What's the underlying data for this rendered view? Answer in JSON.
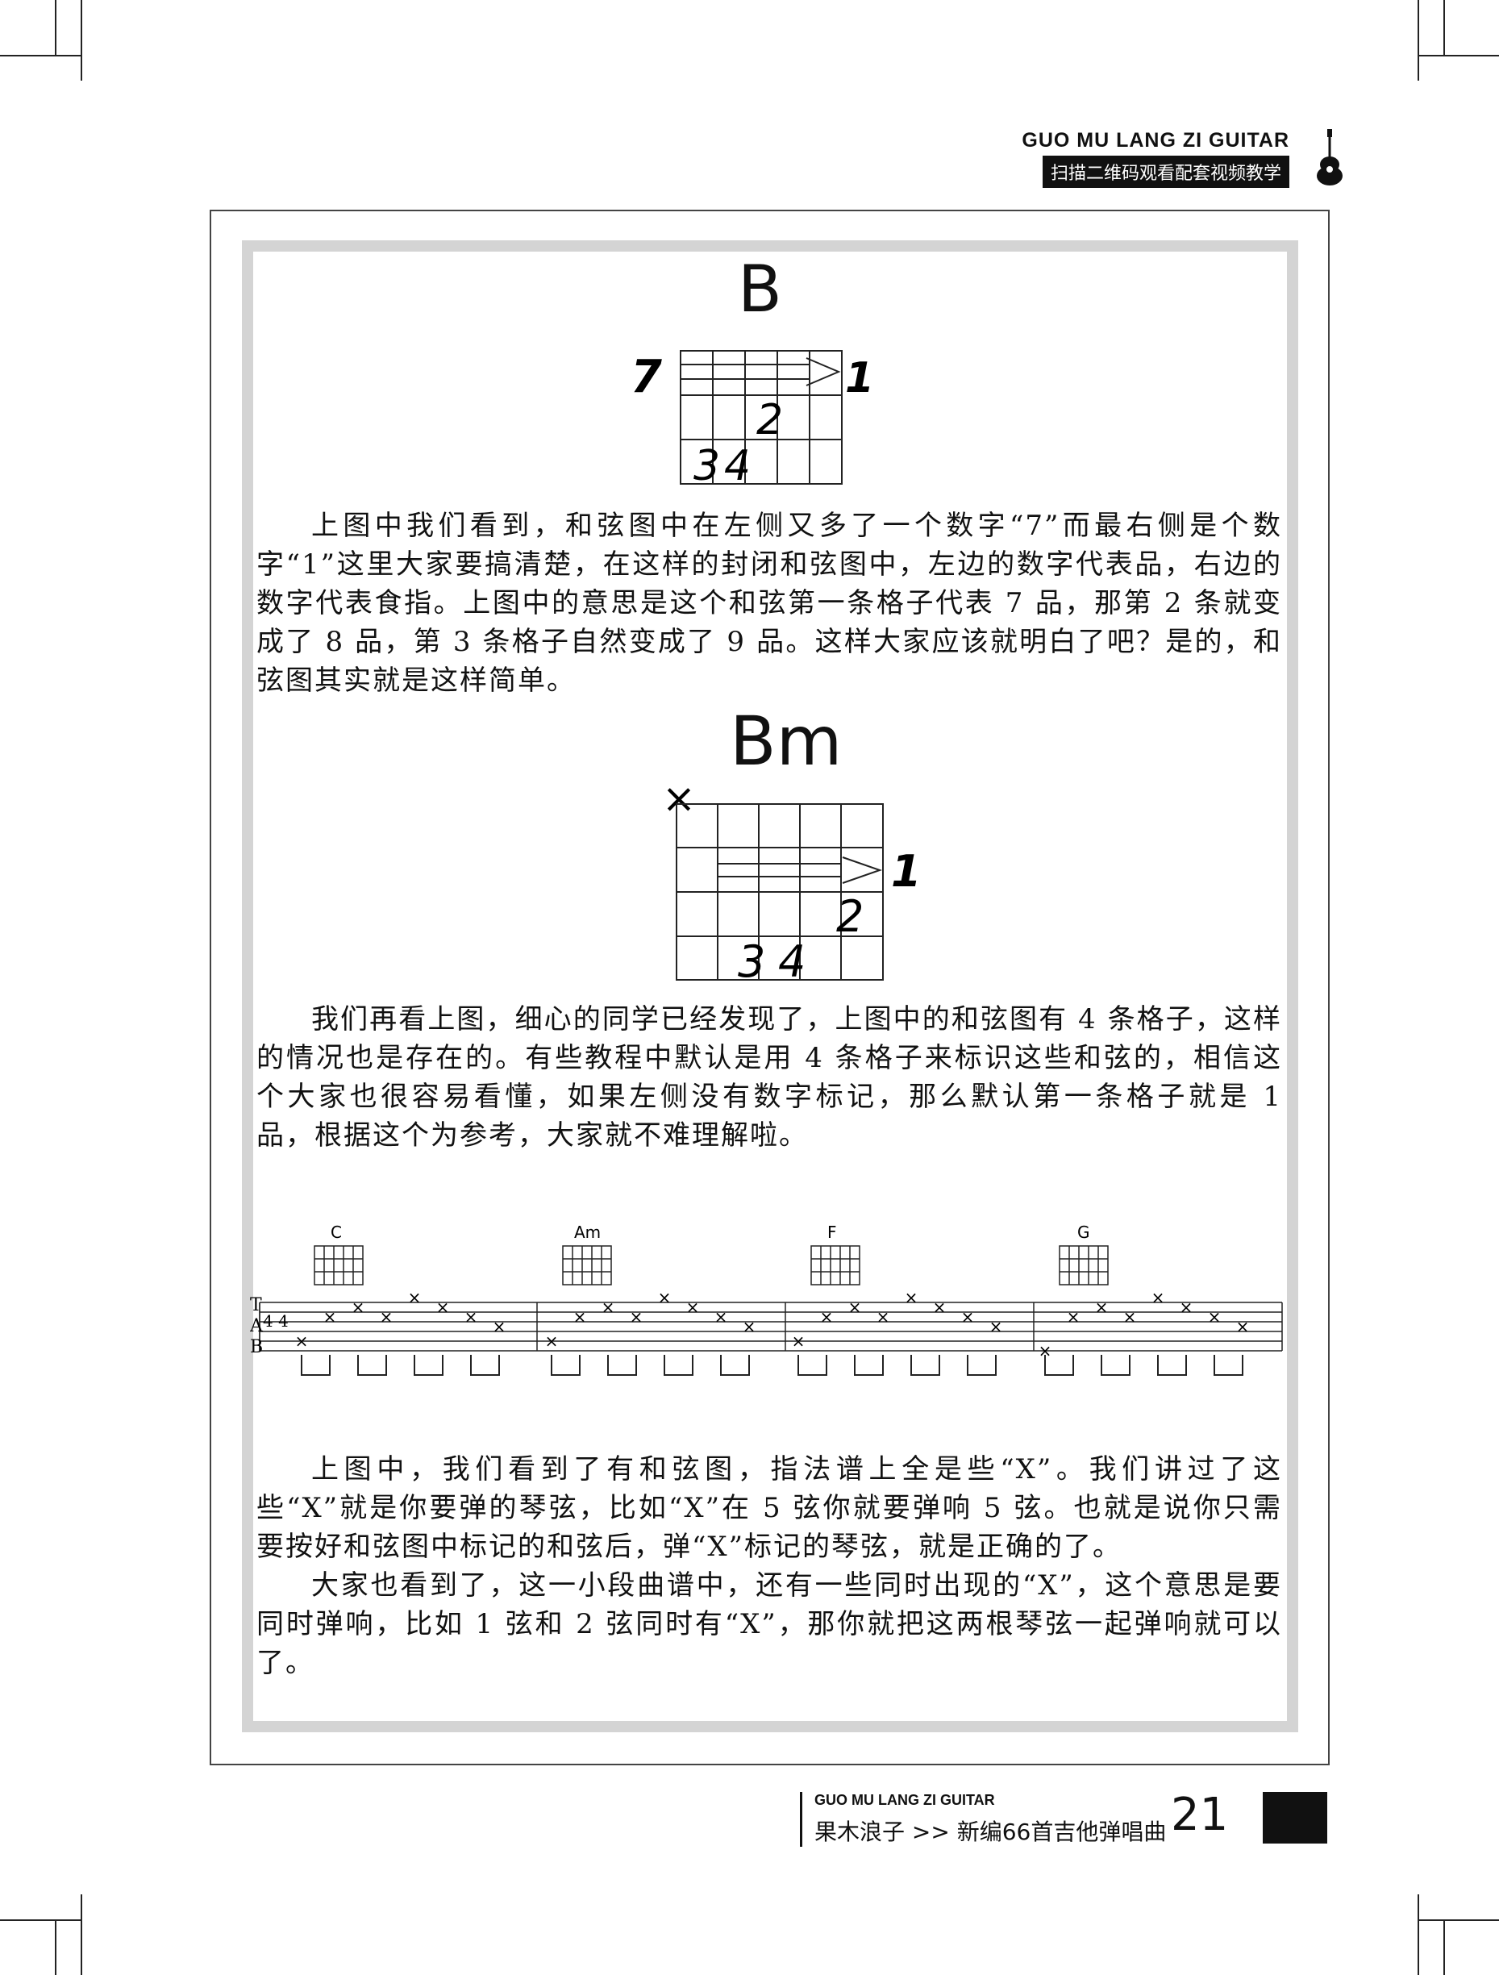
{
  "header": {
    "brand": "GUO MU LANG ZI GUITAR",
    "subtitle": "扫描二维码观看配套视频教学"
  },
  "section_b": {
    "chord_name": "B",
    "fret_label": "7",
    "finger_labels": [
      "1",
      "2",
      "3",
      "4"
    ]
  },
  "paragraph1": "上图中我们看到，和弦图中在左侧又多了一个数字“7”而最右侧是个数字“1”这里大家要搞清楚，在这样的封闭和弦图中，左边的数字代表品，右边的数字代表食指。上图中的意思是这个和弦第一条格子代表 7 品，那第 2 条就变成了 8 品，第 3 条格子自然变成了 9 品。这样大家应该就明白了吧？是的，和弦图其实就是这样简单。",
  "section_bm": {
    "chord_name": "Bm",
    "mute_mark": "×",
    "finger_labels": [
      "1",
      "2",
      "3",
      "4"
    ]
  },
  "paragraph2": "我们再看上图，细心的同学已经发现了，上图中的和弦图有 4 条格子，这样的情况也是存在的。有些教程中默认是用 4 条格子来标识这些和弦的，相信这个大家也很容易看懂，如果左侧没有数字标记，那么默认第一条格子就是 1 品，根据这个为参考，大家就不难理解啦。",
  "tab": {
    "chords": [
      "C",
      "Am",
      "F",
      "G"
    ],
    "time_sig": "4 4",
    "tab_letters": [
      "T",
      "A",
      "B"
    ]
  },
  "paragraph3": "上图中，我们看到了有和弦图，指法谱上全是些“X”。我们讲过了这些“X”就是你要弹的琴弦，比如“X”在 5 弦你就要弹响 5 弦。也就是说你只需要按好和弦图中标记的和弦后，弹“X”标记的琴弦，就是正确的了。",
  "paragraph4": "大家也看到了，这一小段曲谱中，还有一些同时出现的“X”，这个意思是要同时弹响，比如 1 弦和 2 弦同时有“X”，那你就把这两根琴弦一起弹响就可以了。",
  "footer": {
    "brand": "GUO MU LANG ZI GUITAR",
    "book": "果木浪子 >> 新编66首吉他弹唱曲",
    "page_number": "21"
  }
}
